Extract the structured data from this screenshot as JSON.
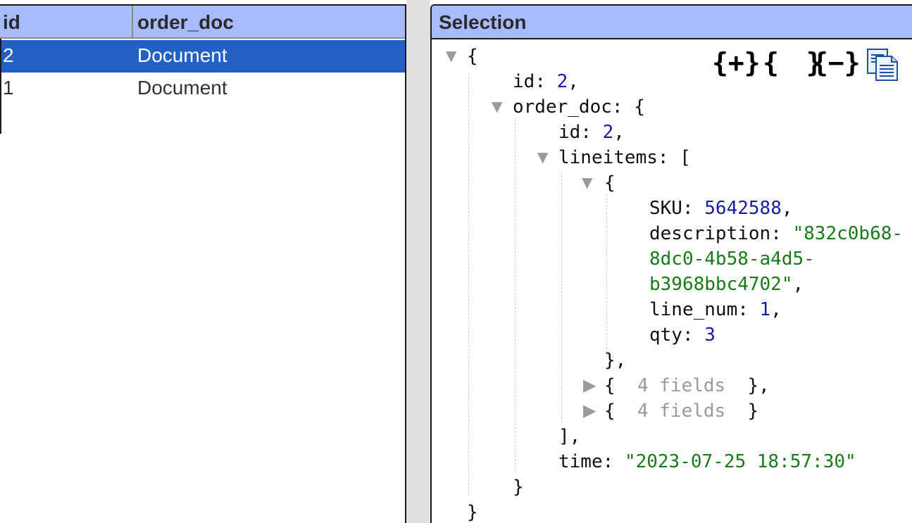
{
  "grid": {
    "columns": [
      "id",
      "order_doc"
    ],
    "rows": [
      {
        "id": "2",
        "order_doc": "Document",
        "selected": true
      },
      {
        "id": "1",
        "order_doc": "Document",
        "selected": false
      }
    ]
  },
  "selection": {
    "title": "Selection",
    "toolbar": {
      "expand_all": "{+}",
      "braces": "{}",
      "collapse_all": "{−}",
      "copy_icon": "copy-document-icon"
    },
    "tree": {
      "open_brace": "{",
      "id_key": "id",
      "id_value": "2",
      "order_doc_key": "order_doc",
      "inner_open": "{",
      "inner_id_key": "id",
      "inner_id_value": "2",
      "lineitems_key": "lineitems",
      "array_open": "[",
      "item_open": "{",
      "sku_key": "SKU",
      "sku_value": "5642588",
      "description_key": "description",
      "description_value_l1": "\"832c0b68-",
      "description_value_l2": "8dc0-4b58-a4d5-",
      "description_value_l3": "b3968bbc4702\"",
      "line_num_key": "line_num",
      "line_num_value": "1",
      "qty_key": "qty",
      "qty_value": "3",
      "item_close": "},",
      "collapsed_1": "4 fields",
      "collapsed_2": "4 fields",
      "array_close": "],",
      "time_key": "time",
      "time_value": "\"2023-07-25 18:57:30\"",
      "inner_close": "}",
      "close_brace": "}"
    }
  }
}
